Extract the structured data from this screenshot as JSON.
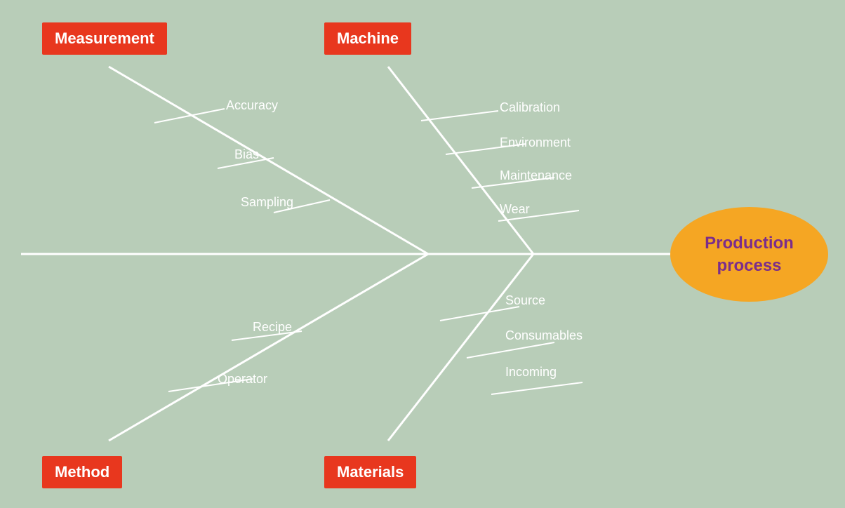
{
  "background_color": "#b8cdb8",
  "categories": {
    "measurement": {
      "label": "Measurement",
      "position": "top-left",
      "branches": [
        "Accuracy",
        "Bias",
        "Sampling"
      ]
    },
    "machine": {
      "label": "Machine",
      "position": "top-right",
      "branches": [
        "Calibration",
        "Environment",
        "Maintenance",
        "Wear"
      ]
    },
    "method": {
      "label": "Method",
      "position": "bottom-left",
      "branches": [
        "Recipe",
        "Operator"
      ]
    },
    "materials": {
      "label": "Materials",
      "position": "bottom-right",
      "branches": [
        "Source",
        "Consumables",
        "Incoming"
      ]
    }
  },
  "center": {
    "label": "Production\nprocess",
    "label_display": "Production process"
  }
}
